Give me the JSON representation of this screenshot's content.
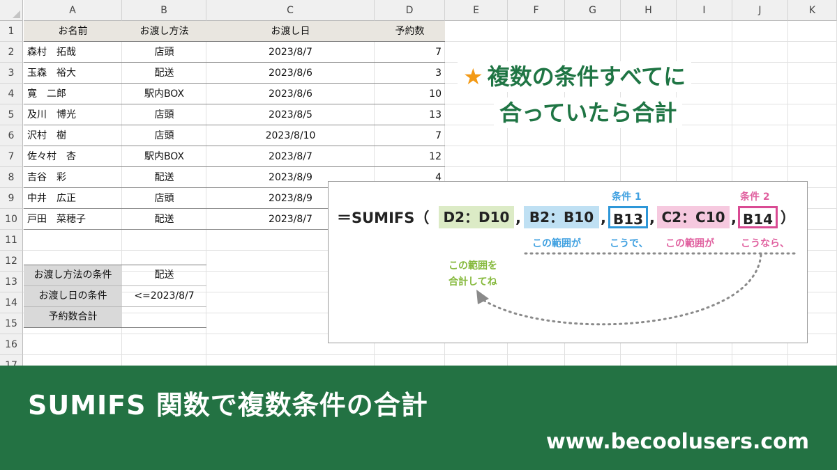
{
  "spreadsheet": {
    "columns": [
      "A",
      "B",
      "C",
      "D",
      "E",
      "F",
      "G",
      "H",
      "I",
      "J",
      "K"
    ],
    "rows": [
      "1",
      "2",
      "3",
      "4",
      "5",
      "6",
      "7",
      "8",
      "9",
      "10",
      "11",
      "12",
      "13",
      "14",
      "15",
      "16",
      "17"
    ],
    "table_headers": [
      "お名前",
      "お渡し方法",
      "お渡し日",
      "予約数"
    ],
    "table_rows": [
      [
        "森村　拓哉",
        "店頭",
        "2023/8/7",
        "7"
      ],
      [
        "玉森　裕大",
        "配送",
        "2023/8/6",
        "3"
      ],
      [
        "寛　二郎",
        "駅内BOX",
        "2023/8/6",
        "10"
      ],
      [
        "及川　博光",
        "店頭",
        "2023/8/5",
        "13"
      ],
      [
        "沢村　樹",
        "店頭",
        "2023/8/10",
        "7"
      ],
      [
        "佐々村　杏",
        "駅内BOX",
        "2023/8/7",
        "12"
      ],
      [
        "吉谷　彩",
        "配送",
        "2023/8/9",
        "4"
      ],
      [
        "中井　広正",
        "店頭",
        "2023/8/9",
        ""
      ],
      [
        "戸田　菜穂子",
        "配送",
        "2023/8/7",
        ""
      ]
    ],
    "criteria": [
      {
        "label": "お渡し方法の条件",
        "value": "配送"
      },
      {
        "label": "お渡し日の条件",
        "value": "<=2023/8/7"
      },
      {
        "label": "予約数合計",
        "value": ""
      }
    ]
  },
  "callout": {
    "star_icon": "star-icon",
    "line1": "複数の条件すべてに",
    "line2": "合っていたら合計"
  },
  "formula": {
    "prefix": "＝SUMIFS（",
    "sum_range": "D2：D10",
    "criteria_range1": "B2：B10",
    "criteria1": "B13",
    "criteria_range2": "C2：C10",
    "criteria2": "B14",
    "comma": ",",
    "close": "）",
    "label_cond1": "条件 1",
    "label_cond2": "条件 2",
    "note_range1": "この範囲が",
    "note_cond1": "こうで、",
    "note_range2": "この範囲が",
    "note_cond2": "こうなら、",
    "note_sum_line1": "この範囲を",
    "note_sum_line2": "合計してね"
  },
  "banner": {
    "title": "SUMIFS 関数で複数条件の合計",
    "url": "www.becoolusers.com"
  },
  "colors": {
    "green_brand": "#237243",
    "callout_text": "#1f7544",
    "star": "#f39a16",
    "pill_green": "#dcebc6",
    "pill_blue": "#bfe0f3",
    "box_blue": "#2e97d8",
    "pill_pink": "#f6c9df",
    "box_pink": "#d94b93"
  }
}
